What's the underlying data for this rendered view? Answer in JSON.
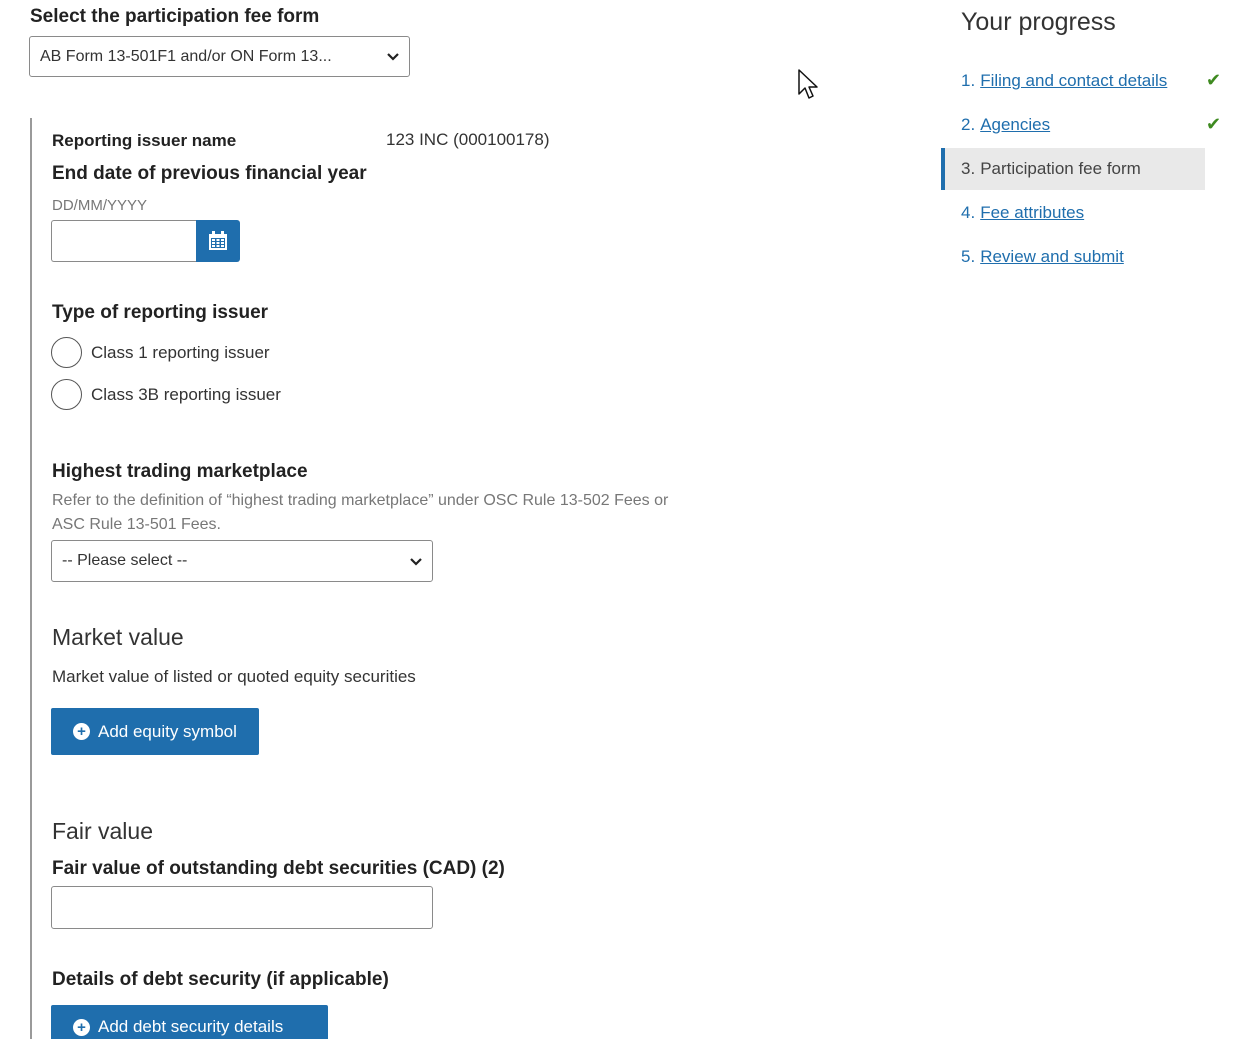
{
  "form_select": {
    "label": "Select the participation fee form",
    "value": "AB Form 13-501F1 and/or ON Form 13..."
  },
  "issuer": {
    "label": "Reporting issuer name",
    "value": "123 INC (000100178)"
  },
  "end_date": {
    "label": "End date of previous financial year",
    "format_hint": "DD/MM/YYYY",
    "value": ""
  },
  "issuer_type": {
    "label": "Type of reporting issuer",
    "options": [
      "Class 1 reporting issuer",
      "Class 3B reporting issuer"
    ]
  },
  "marketplace": {
    "label": "Highest trading marketplace",
    "hint_line1": "Refer to the definition of “highest trading marketplace” under OSC Rule 13-502 Fees or",
    "hint_line2": "ASC Rule 13-501 Fees.",
    "value": "-- Please select --"
  },
  "market_value": {
    "title": "Market value",
    "description": "Market value of listed or quoted equity securities",
    "button_label": "Add equity symbol"
  },
  "fair_value": {
    "title": "Fair value",
    "field_label": "Fair value of outstanding debt securities (CAD) (2)",
    "value": "",
    "details_label": "Details of debt security (if applicable)",
    "button_label": "Add debt security details"
  },
  "progress": {
    "title": "Your progress",
    "steps": [
      {
        "num": "1.",
        "label": "Filing and contact details",
        "status": "complete"
      },
      {
        "num": "2.",
        "label": "Agencies",
        "status": "complete"
      },
      {
        "num": "3.",
        "label": "Participation fee form",
        "status": "current"
      },
      {
        "num": "4.",
        "label": "Fee attributes",
        "status": "pending"
      },
      {
        "num": "5.",
        "label": "Review and submit",
        "status": "pending"
      }
    ],
    "check_glyph": "✔"
  },
  "colors": {
    "primary": "#1f6ead",
    "check": "#3e8a20",
    "current_step_bg": "#e9e9e9"
  },
  "icons": [
    "chevron-down-icon",
    "calendar-icon",
    "plus-circle-icon",
    "checkmark-icon",
    "mouse-cursor-icon"
  ]
}
